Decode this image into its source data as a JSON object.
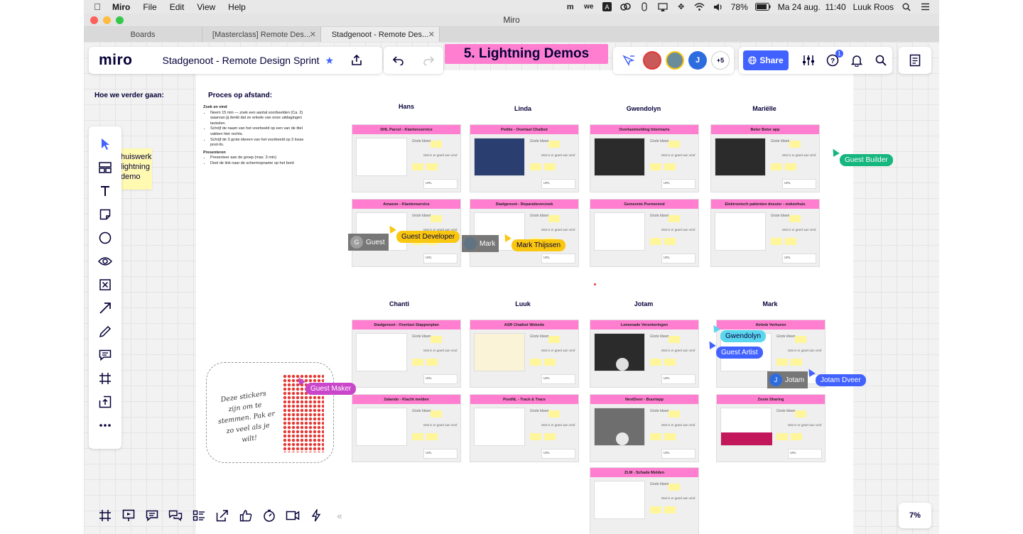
{
  "menubar": {
    "app": "Miro",
    "items": [
      "File",
      "Edit",
      "View",
      "Help"
    ],
    "battery": "78%",
    "datetime": "Ma 24 aug.  11:40",
    "user": "Luuk Roos"
  },
  "window": {
    "title": "Miro",
    "tabs": [
      {
        "label": "Boards"
      },
      {
        "label": "[Masterclass] Remote Des..."
      },
      {
        "label": "Stadgenoot - Remote Des..."
      }
    ]
  },
  "topbar": {
    "logo": "miro",
    "board_title": "Stadgenoot - Remote Design Sprint",
    "frame_title": "5. Lightning Demos",
    "collaborator_initial": "J",
    "more_count": "+5",
    "share_label": "Share",
    "help_badge": "1"
  },
  "zoom": "7%",
  "board": {
    "hoe_label": "Hoe we verder gaan:",
    "sticky_note": "huiswerk\nlightning\ndemo",
    "proces_title": "Proces op afstand:",
    "zoek_heading": "Zoek en vind",
    "zoek_items": [
      "Neem 15 min — zoek een aantal voorbeelden (Ca. 2) waarvan jij denkt dat ze enkele van onze uitdagingen tackelen.",
      "Schrijf de naam van het voorbeeld op een van de titel vakken hier rechts.",
      "Schrijf de 3 grote ideeen van het voorbeeld op 3 losse post-its."
    ],
    "presenteren_heading": "Presenteren",
    "presenteren_items": [
      "Presenteer aan de groep (max. 3 min)",
      "Deel de link naar de schermopname op het bord"
    ],
    "stickers_text": "Deze stickers zijn om te stemmen. Pak er zo veel als je wilt!",
    "card_sub1": "Grote Ideen",
    "card_sub2": "Wat is er goed aan vind",
    "card_url": "URL",
    "people": {
      "hans": "Hans",
      "linda": "Linda",
      "gwendolyn": "Gwendolyn",
      "marielle": "Mariëlle",
      "chanti": "Chanti",
      "luuk": "Luuk",
      "jotam": "Jotam",
      "mark": "Mark"
    },
    "cards": {
      "c1": "DHL Parcel - Klantenservice",
      "c2": "Petitie - Overlast Chatbot",
      "c3": "Overlastmelding Intermaris",
      "c4": "Beter Beter app",
      "c5": "Amazon - Klantenservice",
      "c6": "Stadgenoot - Reparatieverzoek",
      "c7": "Gemeente Purmerend",
      "c8": "Elektronisch patienten dossier - ziekenhuis",
      "c9": "Stadgenoot - Overlast Stappenplan",
      "c10": "ASR Chatbot Website",
      "c11": "Lemonade Verzekeringen",
      "c12": "Airbnb Verhuren",
      "c13": "Zalando - Klacht melden",
      "c14": "PostNL - Track & Trace",
      "c15": "NextDoor - Buurtapp",
      "c16": "Zoom Sharing",
      "c17": "ZLM - Schade Melden"
    }
  },
  "cursors": {
    "guest_builder": "Guest Builder",
    "guest_developer": "Guest Developer",
    "mark_thijssen": "Mark Thijssen",
    "gwendolyn": "Gwendolyn",
    "guest_artist": "Guest Artist",
    "jotam_dveer": "Jotam Dveer",
    "guest_maker": "Guest Maker"
  },
  "chips": {
    "guest_initial": "G",
    "guest": "Guest",
    "mark": "Mark",
    "jotam_initial": "J",
    "jotam": "Jotam"
  },
  "colors": {
    "accent": "#4262ff",
    "frame_pink": "#ff7ed0",
    "sticky_yellow": "#fff9b1",
    "cursor_green": "#16b67f",
    "cursor_yellow": "#fac710",
    "cursor_cyan": "#5bd6ef",
    "cursor_blue": "#4262ff",
    "cursor_magenta": "#c945c9"
  }
}
